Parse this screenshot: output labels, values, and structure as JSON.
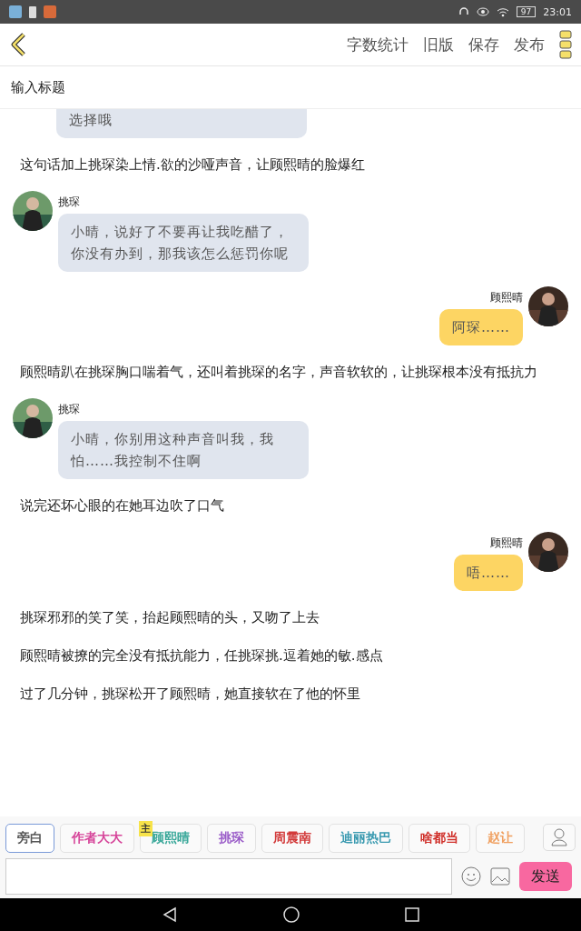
{
  "status_bar": {
    "battery": "97",
    "time": "23:01"
  },
  "toolbar": {
    "actions": [
      "字数统计",
      "旧版",
      "保存",
      "发布"
    ]
  },
  "title_field": {
    "placeholder": "输入标题"
  },
  "feed": [
    {
      "kind": "cut",
      "text": "选择哦"
    },
    {
      "kind": "narration",
      "text": "这句话加上挑琛染上情.欲的沙哑声音，让顾熙晴的脸爆红"
    },
    {
      "kind": "left",
      "name": "挑琛",
      "text": "小晴，说好了不要再让我吃醋了，你没有办到，那我该怎么惩罚你呢"
    },
    {
      "kind": "right",
      "name": "顾熙晴",
      "text": "阿琛……"
    },
    {
      "kind": "narration",
      "text": "顾熙晴趴在挑琛胸口喘着气，还叫着挑琛的名字，声音软软的，让挑琛根本没有抵抗力"
    },
    {
      "kind": "left",
      "name": "挑琛",
      "text": "小晴，你别用这种声音叫我，我怕……我控制不住啊"
    },
    {
      "kind": "narration",
      "text": "说完还坏心眼的在她耳边吹了口气"
    },
    {
      "kind": "right",
      "name": "顾熙晴",
      "text": "唔……"
    },
    {
      "kind": "narration",
      "text": "挑琛邪邪的笑了笑，抬起顾熙晴的头，又吻了上去"
    },
    {
      "kind": "narration",
      "text": "顾熙晴被撩的完全没有抵抗能力，任挑琛挑.逗着她的敏.感点"
    },
    {
      "kind": "narration",
      "text": "过了几分钟，挑琛松开了顾熙晴，她直接软在了他的怀里"
    }
  ],
  "roles": [
    {
      "label": "旁白",
      "color": "#555555",
      "selected": true
    },
    {
      "label": "作者大大",
      "color": "#d6459a",
      "selected": false
    },
    {
      "label": "顾熙晴",
      "color": "#3aa89a",
      "selected": false,
      "badge": "主"
    },
    {
      "label": "挑琛",
      "color": "#9a5cc8",
      "selected": false
    },
    {
      "label": "周震南",
      "color": "#d23a3a",
      "selected": false
    },
    {
      "label": "迪丽热巴",
      "color": "#3a9ab0",
      "selected": false
    },
    {
      "label": "啥都当",
      "color": "#d0302a",
      "selected": false
    },
    {
      "label": "赵让",
      "color": "#f0a060",
      "selected": false
    }
  ],
  "composer": {
    "send": "发送"
  }
}
